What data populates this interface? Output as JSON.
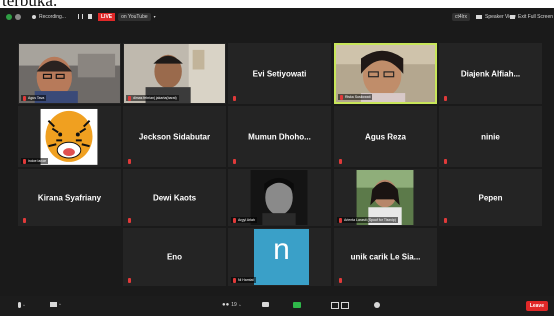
{
  "caption": "terbuka.",
  "topbar": {
    "recording_label": "Recording...",
    "live_label": "LIVE",
    "live_dest": "on YouTube",
    "view_label": "Speaker View",
    "exit_label": "Exit Full Screen",
    "tile_label": "ct4lrx"
  },
  "tiles": [
    {
      "name": "Agus Tava",
      "type": "video"
    },
    {
      "name": "dimas febrian| jakarta(barat)",
      "type": "video"
    },
    {
      "name": "Evi Setiyowati",
      "type": "name"
    },
    {
      "name": "Riska Susilowati",
      "type": "video",
      "active": true
    },
    {
      "name": "Diajenk Alfiah...",
      "type": "name"
    },
    {
      "name": "indoe lanoe",
      "type": "image"
    },
    {
      "name": "Jeckson Sidabutar",
      "type": "name"
    },
    {
      "name": "Mumun Dhoho...",
      "type": "name"
    },
    {
      "name": "Agus Reza",
      "type": "name"
    },
    {
      "name": "ninie",
      "type": "name"
    },
    {
      "name": "Kirana Syafriany",
      "type": "name"
    },
    {
      "name": "Dewi Kaots",
      "type": "name"
    },
    {
      "name": "Argyl Arlah",
      "type": "image"
    },
    {
      "name": "Arienta Larasti (Spoof for Tlsxvip)",
      "type": "image"
    },
    {
      "name": "Pepen",
      "type": "name"
    },
    {
      "name": "Eno",
      "type": "name"
    },
    {
      "name": "Ni Hamtat",
      "type": "letter",
      "letter": "n"
    },
    {
      "name": "unik carik Le Sia...",
      "type": "name"
    }
  ],
  "bottombar": {
    "leave_label": "Leave",
    "participants_count": "19"
  },
  "colors": {
    "active_border": "#c8e65a",
    "live_red": "#e02828",
    "mic_muted": "#e03a3a"
  }
}
